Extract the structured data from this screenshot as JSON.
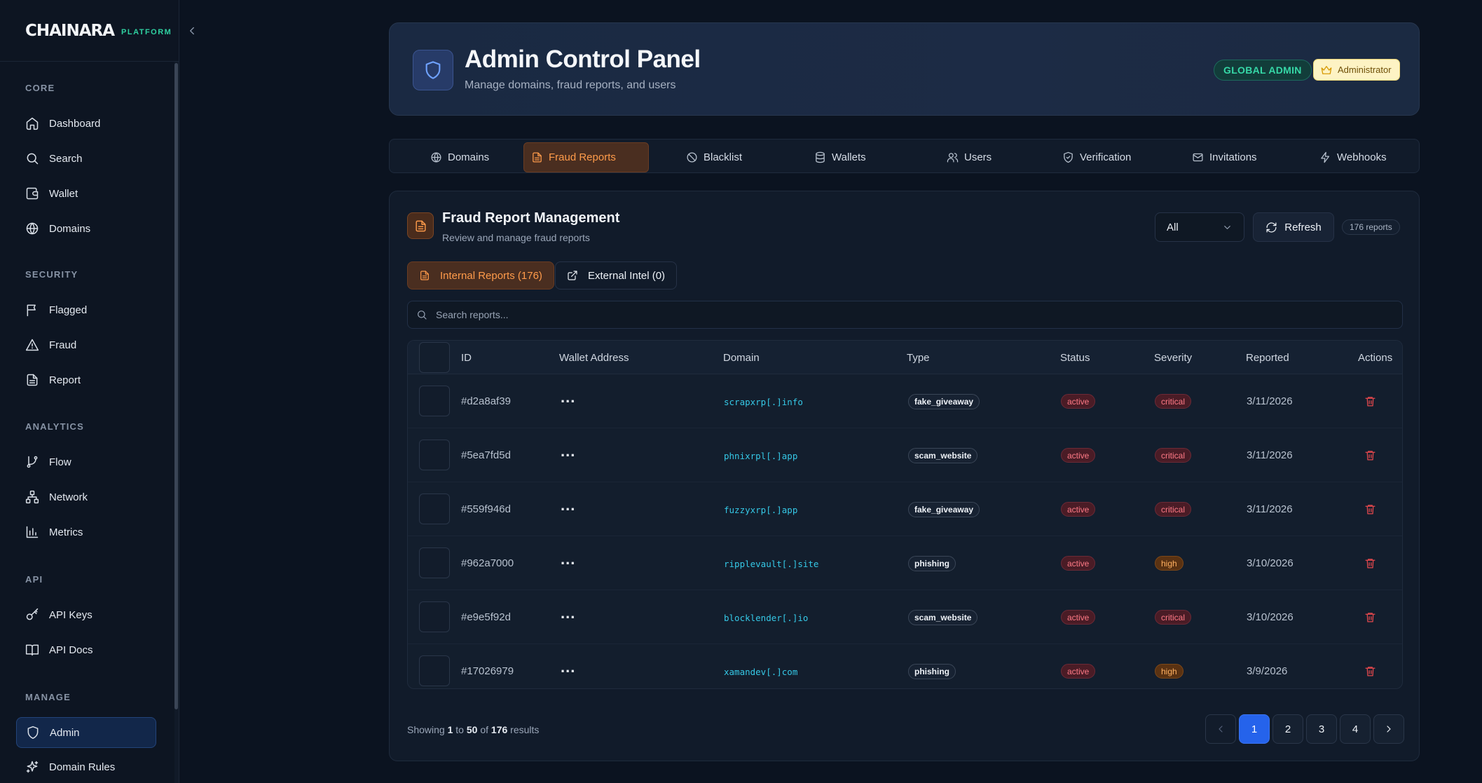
{
  "brand": {
    "logo": "CHAINARA",
    "tag": "PLATFORM"
  },
  "sidebar": {
    "sections": [
      {
        "title": "CORE",
        "items": [
          {
            "label": "Dashboard",
            "icon": "home-icon"
          },
          {
            "label": "Search",
            "icon": "search-icon"
          },
          {
            "label": "Wallet",
            "icon": "wallet-icon"
          },
          {
            "label": "Domains",
            "icon": "globe-icon"
          }
        ]
      },
      {
        "title": "SECURITY",
        "items": [
          {
            "label": "Flagged",
            "icon": "flag-icon"
          },
          {
            "label": "Fraud",
            "icon": "warning-icon"
          },
          {
            "label": "Report",
            "icon": "document-icon"
          }
        ]
      },
      {
        "title": "ANALYTICS",
        "items": [
          {
            "label": "Flow",
            "icon": "git-branch-icon"
          },
          {
            "label": "Network",
            "icon": "network-icon"
          },
          {
            "label": "Metrics",
            "icon": "bar-chart-icon"
          }
        ]
      },
      {
        "title": "API",
        "items": [
          {
            "label": "API Keys",
            "icon": "key-icon"
          },
          {
            "label": "API Docs",
            "icon": "book-icon"
          }
        ]
      },
      {
        "title": "MANAGE",
        "items": [
          {
            "label": "Admin",
            "icon": "shield-icon",
            "active": true
          },
          {
            "label": "Domain Rules",
            "icon": "sparkle-icon"
          }
        ]
      }
    ]
  },
  "header": {
    "title": "Admin Control Panel",
    "subtitle": "Manage domains, fraud reports, and users",
    "badge_global": "GLOBAL ADMIN",
    "badge_admin": "Administrator"
  },
  "tabs": [
    {
      "label": "Domains",
      "icon": "globe-icon"
    },
    {
      "label": "Fraud Reports",
      "icon": "document-icon",
      "active": true
    },
    {
      "label": "Blacklist",
      "icon": "ban-icon"
    },
    {
      "label": "Wallets",
      "icon": "database-icon"
    },
    {
      "label": "Users",
      "icon": "users-icon"
    },
    {
      "label": "Verification",
      "icon": "shield-check-icon"
    },
    {
      "label": "Invitations",
      "icon": "mail-icon"
    },
    {
      "label": "Webhooks",
      "icon": "zap-icon"
    }
  ],
  "panel": {
    "title": "Fraud Report Management",
    "subtitle": "Review and manage fraud reports",
    "filter_value": "All",
    "refresh_label": "Refresh",
    "count": "176 reports",
    "subtab_internal": "Internal Reports (176)",
    "subtab_external": "External Intel (0)",
    "search_placeholder": "Search reports..."
  },
  "table": {
    "columns": [
      "ID",
      "Wallet Address",
      "Domain",
      "Type",
      "Status",
      "Severity",
      "Reported",
      "Actions"
    ],
    "rows": [
      {
        "id": "#d2a8af39",
        "wallet": "...",
        "domain": "scrapxrp[.]info",
        "type": "fake_giveaway",
        "status": "active",
        "severity": "critical",
        "reported": "3/11/2026"
      },
      {
        "id": "#5ea7fd5d",
        "wallet": "...",
        "domain": "phnixrpl[.]app",
        "type": "scam_website",
        "status": "active",
        "severity": "critical",
        "reported": "3/11/2026"
      },
      {
        "id": "#559f946d",
        "wallet": "...",
        "domain": "fuzzyxrp[.]app",
        "type": "fake_giveaway",
        "status": "active",
        "severity": "critical",
        "reported": "3/11/2026"
      },
      {
        "id": "#962a7000",
        "wallet": "...",
        "domain": "ripplevault[.]site",
        "type": "phishing",
        "status": "active",
        "severity": "high",
        "reported": "3/10/2026"
      },
      {
        "id": "#e9e5f92d",
        "wallet": "...",
        "domain": "blocklender[.]io",
        "type": "scam_website",
        "status": "active",
        "severity": "critical",
        "reported": "3/10/2026"
      },
      {
        "id": "#17026979",
        "wallet": "...",
        "domain": "xamandev[.]com",
        "type": "phishing",
        "status": "active",
        "severity": "high",
        "reported": "3/9/2026"
      }
    ]
  },
  "pagination": {
    "showing_prefix": "Showing",
    "from": "1",
    "to_word": "to",
    "to": "50",
    "of_word": "of",
    "total": "176",
    "suffix": "results",
    "pages": [
      "1",
      "2",
      "3",
      "4"
    ]
  },
  "colors": {
    "accent": "#ff9b4a",
    "primary": "#2563eb",
    "success": "#36d8a7",
    "danger": "#ff7a86"
  }
}
